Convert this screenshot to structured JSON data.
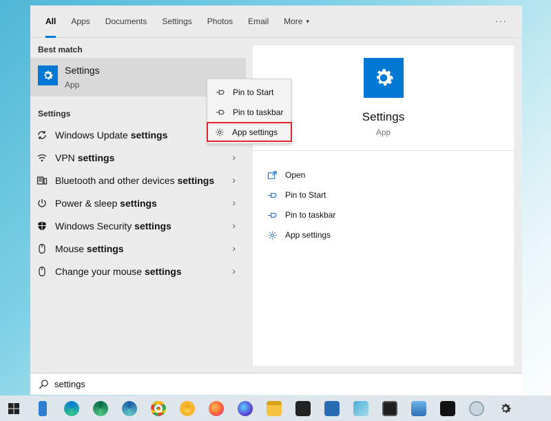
{
  "tabs": {
    "items": [
      "All",
      "Apps",
      "Documents",
      "Settings",
      "Photos",
      "Email",
      "More"
    ],
    "active": "All",
    "more_caret": "▾",
    "overflow": "···"
  },
  "left": {
    "best_match_label": "Best match",
    "best_match": {
      "title": "Settings",
      "subtitle": "App",
      "icon": "gear-icon"
    },
    "settings_label": "Settings",
    "items": [
      {
        "text": "Windows Update ",
        "bold": "settings",
        "icon": "refresh-icon"
      },
      {
        "text": "VPN ",
        "bold": "settings",
        "icon": "vpn-icon"
      },
      {
        "text": "Bluetooth and other devices ",
        "bold": "settings",
        "icon": "devices-icon"
      },
      {
        "text": "Power & sleep ",
        "bold": "settings",
        "icon": "power-icon"
      },
      {
        "text": "Windows Security ",
        "bold": "settings",
        "icon": "shield-icon"
      },
      {
        "text": "Mouse ",
        "bold": "settings",
        "icon": "mouse-icon"
      },
      {
        "text": "Change your mouse ",
        "bold": "settings",
        "icon": "mouse-icon"
      }
    ],
    "chevron": "›"
  },
  "context_menu": {
    "items": [
      {
        "label": "Pin to Start",
        "icon": "pin-icon"
      },
      {
        "label": "Pin to taskbar",
        "icon": "pin-icon"
      },
      {
        "label": "App settings",
        "icon": "gear-icon",
        "highlighted": true
      }
    ]
  },
  "right": {
    "title": "Settings",
    "subtitle": "App",
    "actions": [
      {
        "label": "Open",
        "icon": "open-icon"
      },
      {
        "label": "Pin to Start",
        "icon": "pin-icon"
      },
      {
        "label": "Pin to taskbar",
        "icon": "pin-icon"
      },
      {
        "label": "App settings",
        "icon": "gear-icon"
      }
    ]
  },
  "search": {
    "value": "settings",
    "icon": "search-icon"
  },
  "taskbar": {
    "apps": [
      "start",
      "phone",
      "edge",
      "edge-dev",
      "edge-canary",
      "chrome",
      "chrome-canary",
      "firefox",
      "firefox-nightly",
      "file-explorer",
      "store",
      "powershell",
      "app-blue",
      "terminal",
      "photos",
      "command-prompt",
      "vpn",
      "settings"
    ]
  },
  "colors": {
    "accent": "#0078d4",
    "highlight_border": "#d9262b"
  }
}
